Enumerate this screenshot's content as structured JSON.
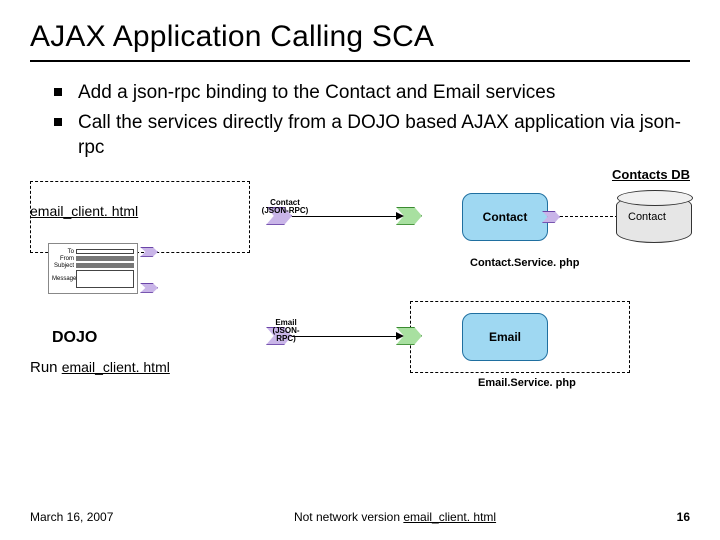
{
  "title": "AJAX Application Calling SCA",
  "bullets": {
    "b1": "Add a json-rpc binding to the Contact and Email services",
    "b2": "Call the services directly from a DOJO based AJAX application via json-rpc"
  },
  "diagram": {
    "contacts_db": "Contacts DB",
    "email_client_html": "email_client. html",
    "contact_conn": "Contact\n(JSON-RPC)",
    "contact_comp": "Contact",
    "contact_cyl": "Contact",
    "contact_svc_file": "Contact.Service. php",
    "email_conn": "Email\n(JSON-RPC)",
    "email_comp": "Email",
    "email_svc_file": "Email.Service. php",
    "dojo": "DOJO",
    "form": {
      "to": "To",
      "from": "From",
      "subject": "Subject",
      "message": "Message"
    },
    "run_link_pre": "Run ",
    "run_link": "email_client. html"
  },
  "footer": {
    "date": "March 16, 2007",
    "mid_pre": "Not network version ",
    "mid_link": "email_client. html",
    "page": "16"
  }
}
